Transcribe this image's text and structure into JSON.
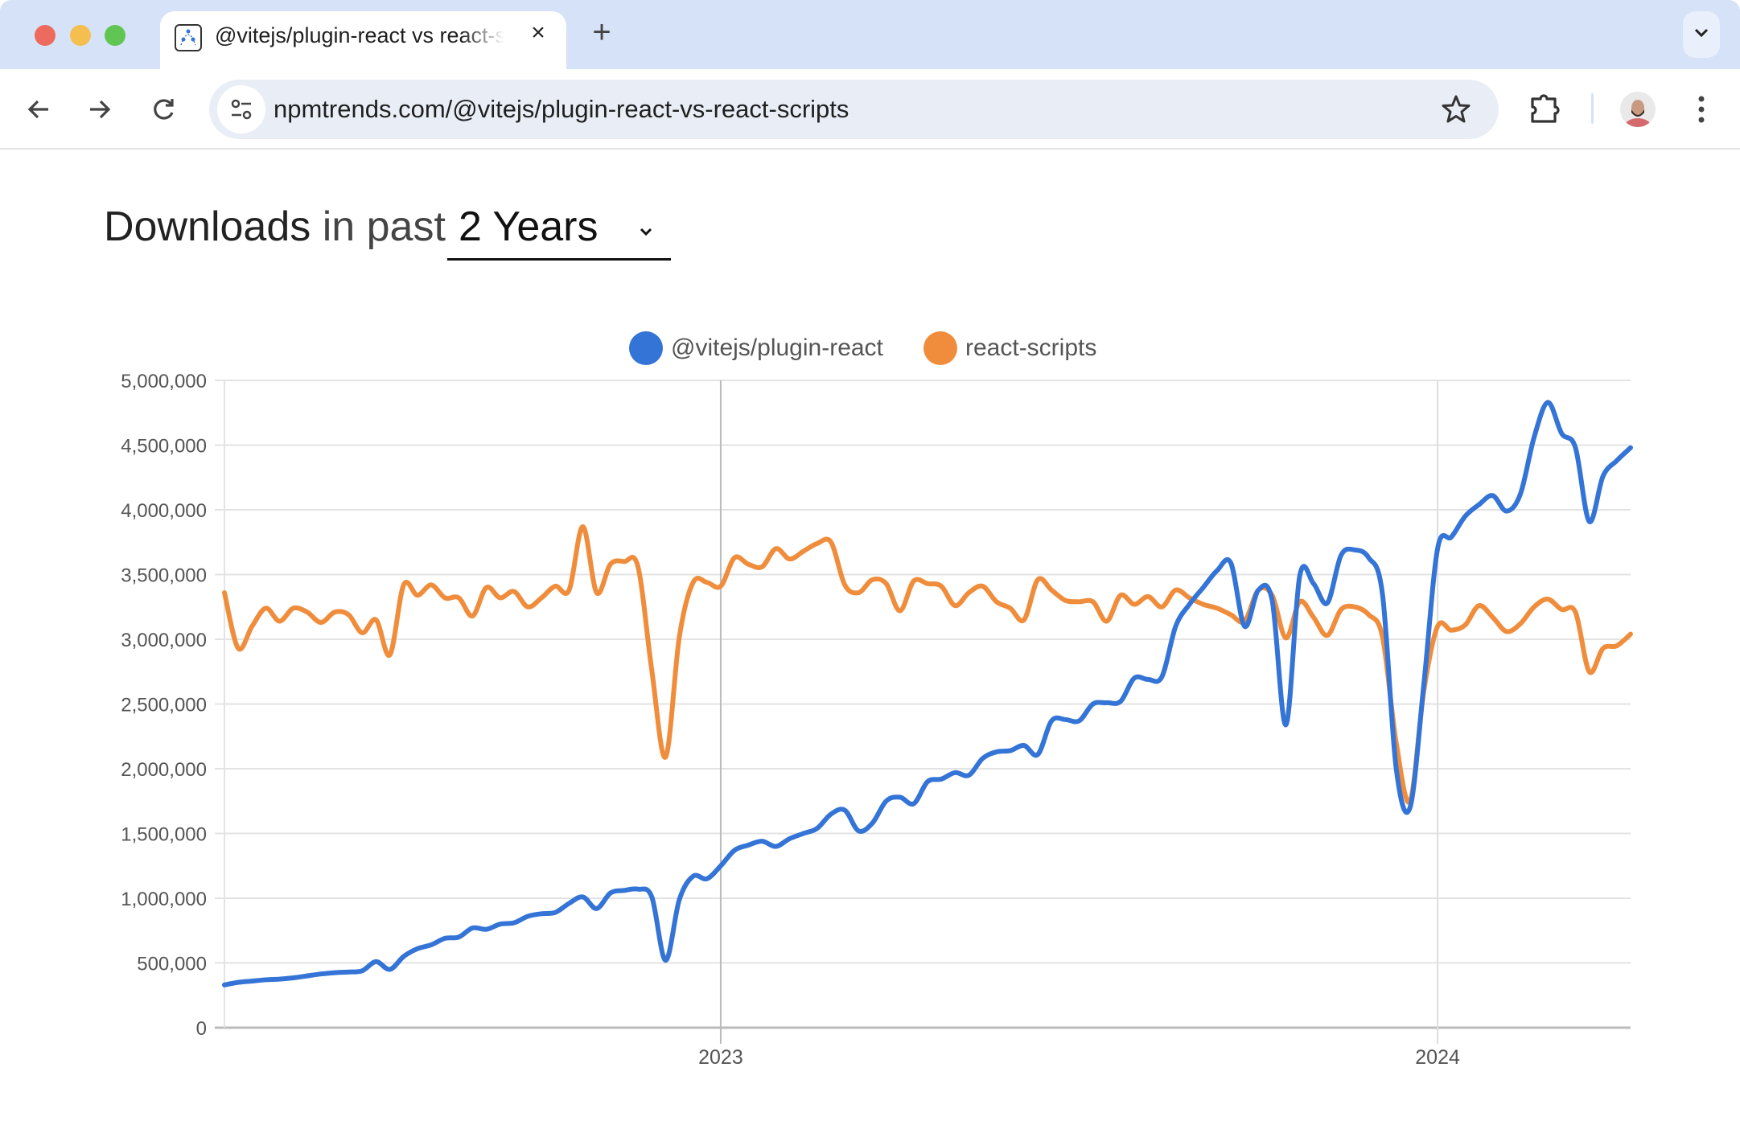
{
  "browser": {
    "tab_title": "@vitejs/plugin-react vs react-scripts",
    "url": "npmtrends.com/@vitejs/plugin-react-vs-react-scripts",
    "icons": {
      "back": "arrow-left-icon",
      "forward": "arrow-right-icon",
      "reload": "reload-icon",
      "site_info": "tune-icon",
      "bookmark": "star-icon",
      "extensions": "puzzle-icon",
      "profile": "avatar",
      "menu": "kebab-menu-icon",
      "tab_search": "chevron-down-icon",
      "new_tab": "plus-icon",
      "close_tab": "close-icon"
    },
    "new_tab_label": "+",
    "close_tab_label": "×"
  },
  "page": {
    "heading_strong": "Downloads",
    "heading_rest": "in past",
    "period_selected": "2 Years"
  },
  "colors": {
    "vite": "#3474d6",
    "react_scripts": "#f08d3c",
    "grid": "#e3e3e3"
  },
  "chart_data": {
    "type": "line",
    "title": "",
    "xlabel": "",
    "ylabel": "",
    "ylim": [
      0,
      5000000
    ],
    "yticks": [
      0,
      500000,
      1000000,
      1500000,
      2000000,
      2500000,
      3000000,
      3500000,
      4000000,
      4500000,
      5000000
    ],
    "ytick_labels": [
      "0",
      "500,000",
      "1,000,000",
      "1,500,000",
      "2,000,000",
      "2,500,000",
      "3,000,000",
      "3,500,000",
      "4,000,000",
      "4,500,000",
      "5,000,000"
    ],
    "xtick_labels": [
      {
        "label": "2023",
        "week_index": 36
      },
      {
        "label": "2024",
        "week_index": 88
      }
    ],
    "x_unit": "week",
    "grid": true,
    "legend": "top-center",
    "series": [
      {
        "name": "@vitejs/plugin-react",
        "values": [
          330000,
          350000,
          360000,
          370000,
          375000,
          385000,
          400000,
          415000,
          425000,
          430000,
          440000,
          510000,
          450000,
          550000,
          610000,
          640000,
          690000,
          700000,
          770000,
          760000,
          800000,
          810000,
          860000,
          880000,
          890000,
          960000,
          1010000,
          920000,
          1040000,
          1060000,
          1070000,
          1010000,
          520000,
          990000,
          1170000,
          1150000,
          1250000,
          1370000,
          1410000,
          1440000,
          1400000,
          1460000,
          1500000,
          1540000,
          1650000,
          1680000,
          1520000,
          1580000,
          1750000,
          1780000,
          1730000,
          1900000,
          1920000,
          1970000,
          1950000,
          2080000,
          2130000,
          2140000,
          2180000,
          2110000,
          2370000,
          2380000,
          2370000,
          2500000,
          2510000,
          2520000,
          2700000,
          2690000,
          2710000,
          3100000,
          3270000,
          3400000,
          3530000,
          3590000,
          3100000,
          3380000,
          3300000,
          2340000,
          3490000,
          3430000,
          3280000,
          3650000,
          3690000,
          3630000,
          3350000,
          2000000,
          1700000,
          2650000,
          3700000,
          3790000,
          3950000,
          4040000,
          4110000,
          3990000,
          4120000,
          4560000,
          4830000,
          4590000,
          4480000,
          3910000,
          4260000,
          4380000,
          4480000
        ]
      },
      {
        "name": "react-scripts",
        "values": [
          3360000,
          2930000,
          3100000,
          3240000,
          3140000,
          3240000,
          3210000,
          3130000,
          3210000,
          3190000,
          3050000,
          3150000,
          2880000,
          3420000,
          3340000,
          3420000,
          3320000,
          3320000,
          3180000,
          3400000,
          3320000,
          3370000,
          3250000,
          3320000,
          3410000,
          3380000,
          3870000,
          3360000,
          3580000,
          3600000,
          3560000,
          2760000,
          2090000,
          3020000,
          3440000,
          3440000,
          3410000,
          3630000,
          3580000,
          3560000,
          3700000,
          3620000,
          3680000,
          3740000,
          3750000,
          3420000,
          3360000,
          3460000,
          3430000,
          3220000,
          3450000,
          3430000,
          3410000,
          3260000,
          3360000,
          3410000,
          3290000,
          3240000,
          3150000,
          3460000,
          3380000,
          3300000,
          3290000,
          3290000,
          3140000,
          3340000,
          3270000,
          3330000,
          3250000,
          3380000,
          3320000,
          3270000,
          3240000,
          3190000,
          3140000,
          3380000,
          3340000,
          3010000,
          3290000,
          3170000,
          3030000,
          3230000,
          3250000,
          3190000,
          3020000,
          2200000,
          1750000,
          2600000,
          3100000,
          3070000,
          3110000,
          3260000,
          3170000,
          3060000,
          3120000,
          3250000,
          3310000,
          3230000,
          3210000,
          2750000,
          2930000,
          2950000,
          3040000
        ]
      }
    ]
  }
}
